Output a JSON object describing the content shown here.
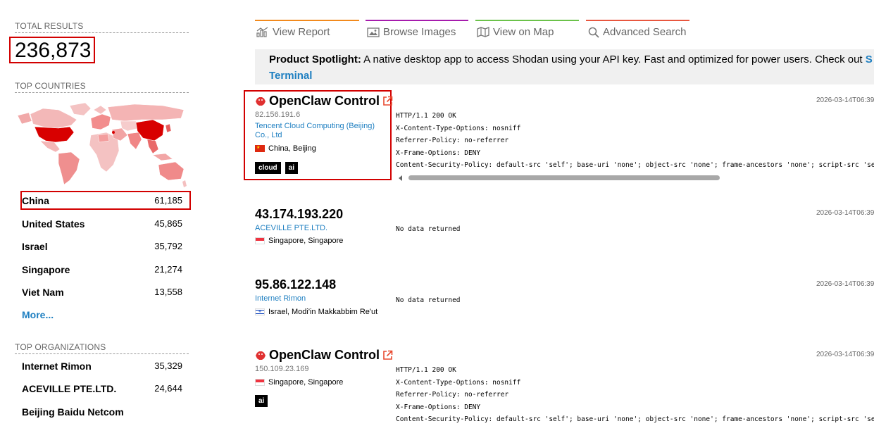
{
  "sidebar": {
    "total_results_title": "TOTAL RESULTS",
    "total_results_value": "236,873",
    "top_countries_title": "TOP COUNTRIES",
    "countries": [
      {
        "name": "China",
        "count": "61,185"
      },
      {
        "name": "United States",
        "count": "45,865"
      },
      {
        "name": "Israel",
        "count": "35,792"
      },
      {
        "name": "Singapore",
        "count": "21,274"
      },
      {
        "name": "Viet Nam",
        "count": "13,558"
      }
    ],
    "more_label": "More...",
    "top_orgs_title": "TOP ORGANIZATIONS",
    "orgs": [
      {
        "name": "Internet Rimon",
        "count": "35,329"
      },
      {
        "name": "ACEVILLE PTE.LTD.",
        "count": "24,644"
      },
      {
        "name": "Beijing Baidu Netcom",
        "count": ""
      }
    ]
  },
  "tabs": [
    {
      "label": "View Report",
      "icon": "chart-icon",
      "color": "#f28a1d"
    },
    {
      "label": "Browse Images",
      "icon": "images-icon",
      "color": "#a61cad"
    },
    {
      "label": "View on Map",
      "icon": "map-icon",
      "color": "#6bc24a"
    },
    {
      "label": "Advanced Search",
      "icon": "search-icon",
      "color": "#e8573f"
    }
  ],
  "spotlight": {
    "bold": "Product Spotlight:",
    "text": " A native desktop app to access Shodan using your API key. Fast and optimized for power users. Check out ",
    "link_start": "S",
    "link_end": "Terminal"
  },
  "results": [
    {
      "title": "OpenClaw Control",
      "ip": "82.156.191.6",
      "org": "Tencent Cloud Computing (Beijing) Co., Ltd",
      "location": "China, Beijing",
      "flag": "cn",
      "tags": [
        "cloud",
        "ai"
      ],
      "timestamp": "2026-03-14T06:39",
      "data": [
        "HTTP/1.1 200 OK",
        "X-Content-Type-Options: nosniff",
        "Referrer-Policy: no-referrer",
        "X-Frame-Options: DENY",
        "Content-Security-Policy: default-src 'self'; base-uri 'none'; object-src 'none'; frame-ancestors 'none'; script-src 'self';"
      ]
    },
    {
      "title": "43.174.193.220",
      "ip": "",
      "org": "ACEVILLE PTE.LTD.",
      "location": "Singapore, Singapore",
      "flag": "sg",
      "tags": [],
      "timestamp": "2026-03-14T06:39",
      "data": [
        "No data returned"
      ]
    },
    {
      "title": "95.86.122.148",
      "ip": "",
      "org": "Internet Rimon",
      "location": "Israel, Modi'in Makkabbim Re'ut",
      "flag": "il",
      "tags": [],
      "timestamp": "2026-03-14T06:39",
      "data": [
        "No data returned"
      ]
    },
    {
      "title": "OpenClaw Control",
      "ip": "150.109.23.169",
      "org": "",
      "location": "Singapore, Singapore",
      "flag": "sg",
      "tags": [
        "ai"
      ],
      "timestamp": "2026-03-14T06:39",
      "data": [
        "HTTP/1.1 200 OK",
        "X-Content-Type-Options: nosniff",
        "Referrer-Policy: no-referrer",
        "X-Frame-Options: DENY",
        "Content-Security-Policy: default-src 'self'; base-uri 'none'; object-src 'none'; frame-ancestors 'none'; script-src 'self';"
      ]
    }
  ]
}
